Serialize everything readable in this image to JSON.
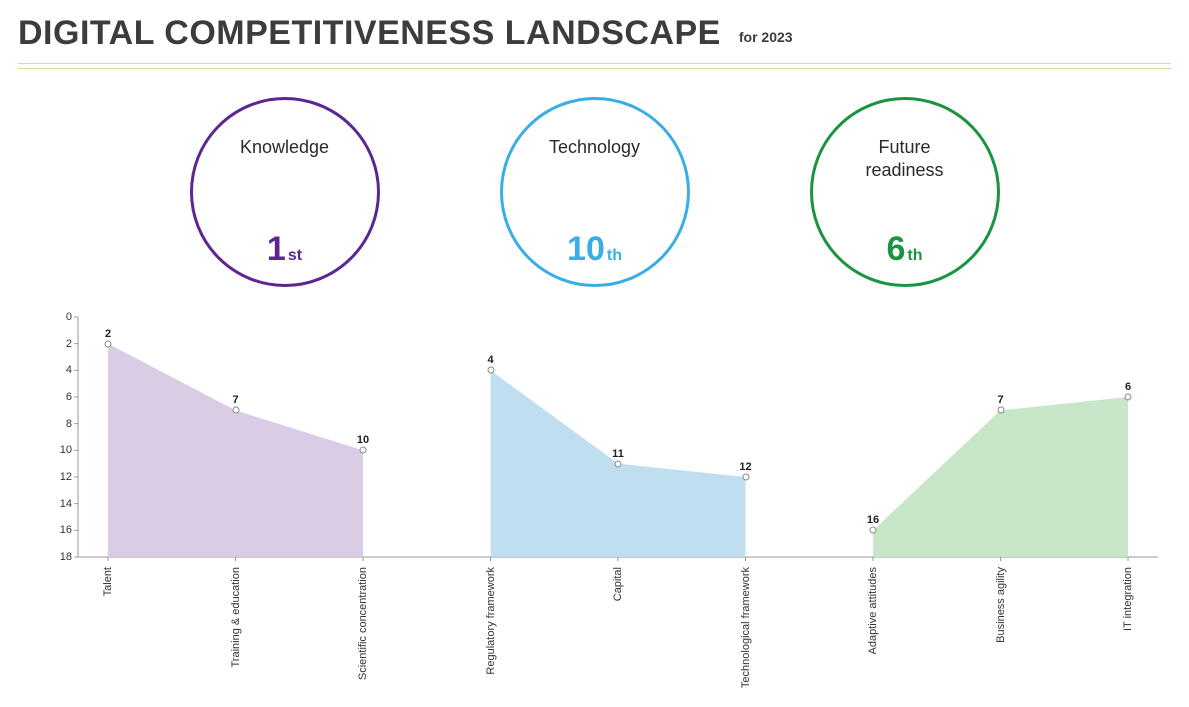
{
  "title": "DIGITAL COMPETITIVENESS LANDSCAPE",
  "year_prefix": "for",
  "year": "2023",
  "pillars": [
    {
      "key": "knowledge",
      "label": "Knowledge",
      "rank_num": "1",
      "rank_ord": "st",
      "color": "#5c2791"
    },
    {
      "key": "tech",
      "label": "Technology",
      "rank_num": "10",
      "rank_ord": "th",
      "color": "#3aaee4"
    },
    {
      "key": "future",
      "label": "Future\nreadiness",
      "rank_num": "6",
      "rank_ord": "th",
      "color": "#1a9441"
    }
  ],
  "chart_data": {
    "type": "area",
    "categories": [
      "Talent",
      "Training & education",
      "Scientific concentration",
      "Regulatory framework",
      "Capital",
      "Technological framework",
      "Adaptive attitudes",
      "Business agility",
      "IT integration"
    ],
    "values": [
      2,
      7,
      10,
      4,
      11,
      12,
      16,
      7,
      6
    ],
    "groups": [
      "knowledge",
      "knowledge",
      "knowledge",
      "tech",
      "tech",
      "tech",
      "future",
      "future",
      "future"
    ],
    "ylim": [
      0,
      18
    ],
    "y_reversed": true,
    "y_ticks": [
      0,
      2,
      4,
      6,
      8,
      10,
      12,
      14,
      16,
      18
    ],
    "colors": {
      "knowledge": "#d7c6e3",
      "tech": "#b8dbf0",
      "future": "#c1e4c2"
    }
  }
}
